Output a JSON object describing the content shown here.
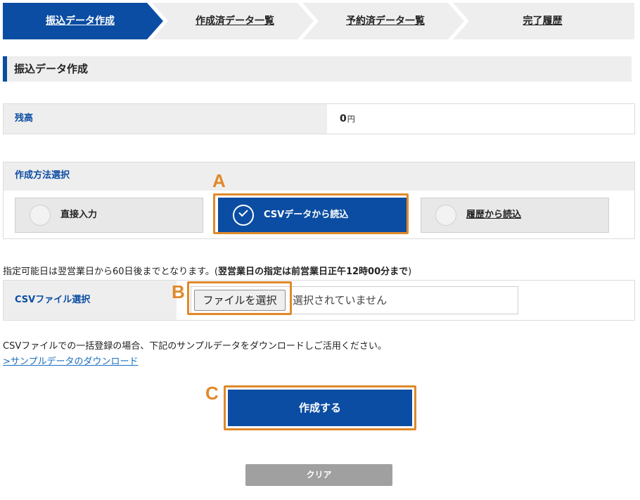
{
  "steps": [
    {
      "label": "振込データ作成",
      "active": true
    },
    {
      "label": "作成済データ一覧",
      "active": false
    },
    {
      "label": "予約済データ一覧",
      "active": false
    },
    {
      "label": "完了履歴",
      "active": false
    }
  ],
  "section": {
    "title": "振込データ作成"
  },
  "balance": {
    "label": "残高",
    "amount": "0",
    "unit": "円"
  },
  "method": {
    "title": "作成方法選択",
    "options": [
      {
        "label": "直接入力",
        "selected": false
      },
      {
        "label": "CSVデータから読込",
        "selected": true
      },
      {
        "label": "履歴から読込",
        "selected": false
      }
    ]
  },
  "notice": {
    "text": "指定可能日は翌営業日から60日後までとなります。(",
    "bold": "翌営業日の指定は前営業日正午12時00分まで",
    "close": ")"
  },
  "csv": {
    "label": "CSVファイル選択",
    "button": "ファイルを選択",
    "status": "選択されていません"
  },
  "info": {
    "text": "CSVファイルでの一括登録の場合、下記のサンプルデータをダウンロードしご活用ください。",
    "link": ">サンプルデータのダウンロード"
  },
  "buttons": {
    "create": "作成する",
    "clear": "クリア"
  },
  "annotations": {
    "a": "A",
    "b": "B",
    "c": "C"
  },
  "colors": {
    "primary": "#0b4da2",
    "highlight": "#e0892a",
    "link": "#1a6fc0"
  }
}
